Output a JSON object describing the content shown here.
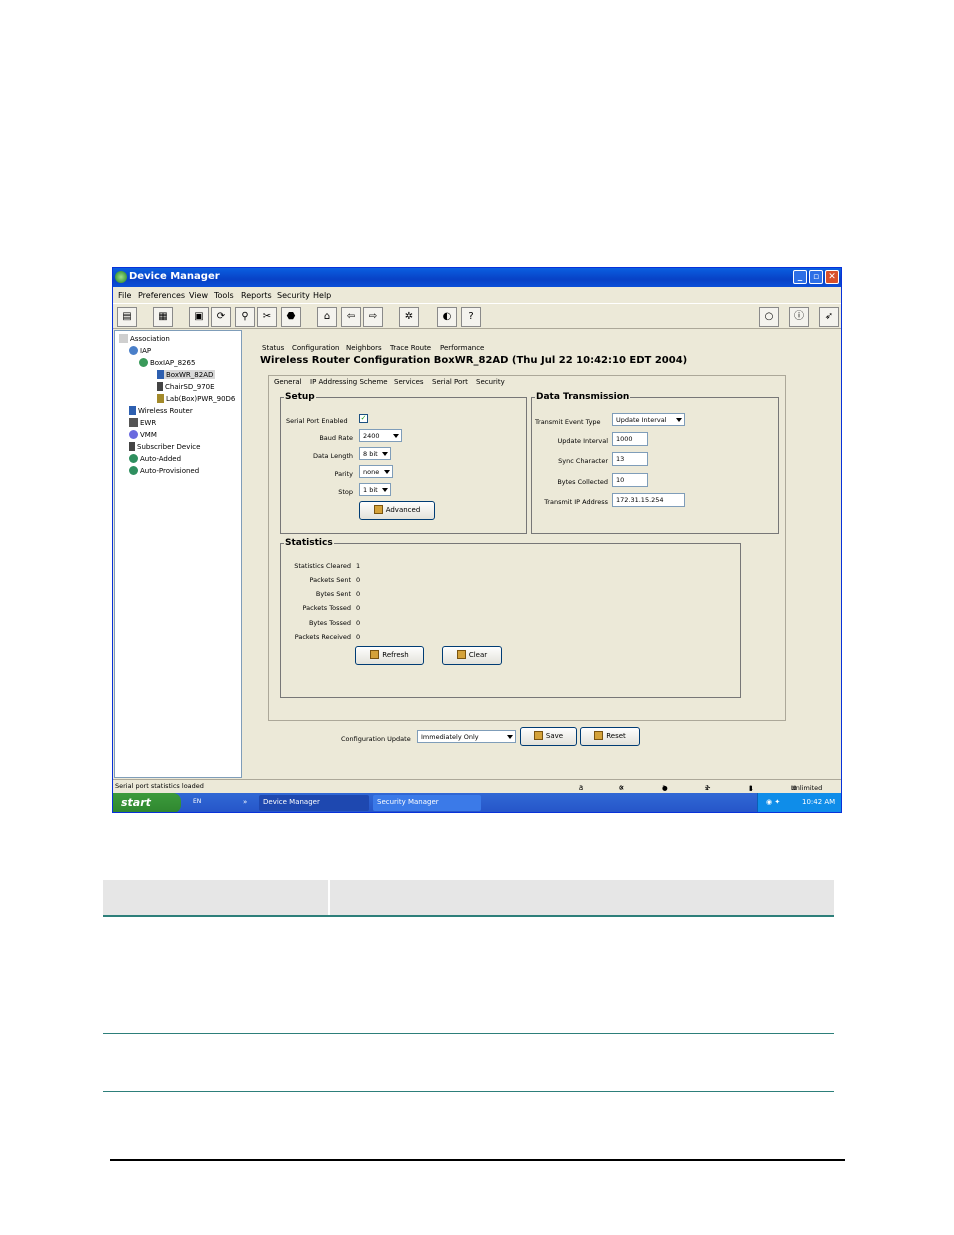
{
  "window": {
    "title": "Device Manager",
    "controls": {
      "minimize": "_",
      "maximize": "▫",
      "close": "✕"
    }
  },
  "menu": [
    "File",
    "Preferences",
    "View",
    "Tools",
    "Reports",
    "Security",
    "Help"
  ],
  "tree": [
    {
      "label": "Association",
      "icon": "association-icon"
    },
    {
      "label": "IAP",
      "icon": "iap-icon"
    },
    {
      "label": "BoxIAP_8265",
      "icon": "box-iap-icon"
    },
    {
      "label": "BoxWR_82AD",
      "icon": "wireless-router-icon",
      "selected": true
    },
    {
      "label": "ChairSD_970E",
      "icon": "subscriber-device-icon"
    },
    {
      "label": "Lab(Box)PWR_90D6",
      "icon": "ewr-icon"
    },
    {
      "label": "Wireless Router",
      "icon": "wireless-router-icon"
    },
    {
      "label": "EWR",
      "icon": "ewr-icon"
    },
    {
      "label": "VMM",
      "icon": "vmm-icon"
    },
    {
      "label": "Subscriber Device",
      "icon": "subscriber-device-icon"
    },
    {
      "label": "Auto-Added",
      "icon": "globe-icon"
    },
    {
      "label": "Auto-Provisioned",
      "icon": "globe-icon"
    }
  ],
  "tabs": [
    "Status",
    "Configuration",
    "Neighbors",
    "Trace Route",
    "Performance"
  ],
  "heading": "Wireless Router Configuration BoxWR_82AD (Thu Jul 22 10:42:10 EDT 2004)",
  "subtabs": [
    "General",
    "IP Addressing Scheme",
    "Services",
    "Serial Port",
    "Security"
  ],
  "setup": {
    "legend": "Setup",
    "serial_port_enabled_label": "Serial Port Enabled",
    "serial_port_enabled_mark": "✓",
    "baud_rate_label": "Baud Rate",
    "baud_rate": "2400",
    "data_length_label": "Data Length",
    "data_length": "8 bit",
    "parity_label": "Parity",
    "parity": "none",
    "stop_label": "Stop",
    "stop": "1 bit",
    "advanced_button": "Advanced"
  },
  "transmission": {
    "legend": "Data Transmission",
    "event_type_label": "Transmit Event Type",
    "event_type": "Update Interval",
    "update_interval_label": "Update Interval",
    "update_interval": "1000",
    "sync_char_label": "Sync Character",
    "sync_char": "13",
    "bytes_collected_label": "Bytes Collected",
    "bytes_collected": "10",
    "ip_label": "Transmit IP Address",
    "ip": "172.31.15.254"
  },
  "statistics": {
    "legend": "Statistics",
    "rows": [
      {
        "label": "Statistics Cleared",
        "value": "1"
      },
      {
        "label": "Packets Sent",
        "value": "0"
      },
      {
        "label": "Bytes Sent",
        "value": "0"
      },
      {
        "label": "Packets Tossed",
        "value": "0"
      },
      {
        "label": "Bytes Tossed",
        "value": "0"
      },
      {
        "label": "Packets Received",
        "value": "0"
      }
    ],
    "refresh_button": "Refresh",
    "clear_button": "Clear"
  },
  "bottom": {
    "config_update_label": "Configuration Update",
    "config_update_value": "Immediately Only",
    "save_button": "Save",
    "reset_button": "Reset"
  },
  "status": {
    "message": "Serial port statistics loaded",
    "counts": [
      "3",
      "0",
      "1",
      "2",
      "1"
    ],
    "mode": "Unlimited"
  },
  "taskbar": {
    "start": "start",
    "tasks": [
      "Device Manager",
      "Security Manager"
    ],
    "clock": "10:42 AM",
    "quick": [
      "EN",
      "»"
    ]
  }
}
